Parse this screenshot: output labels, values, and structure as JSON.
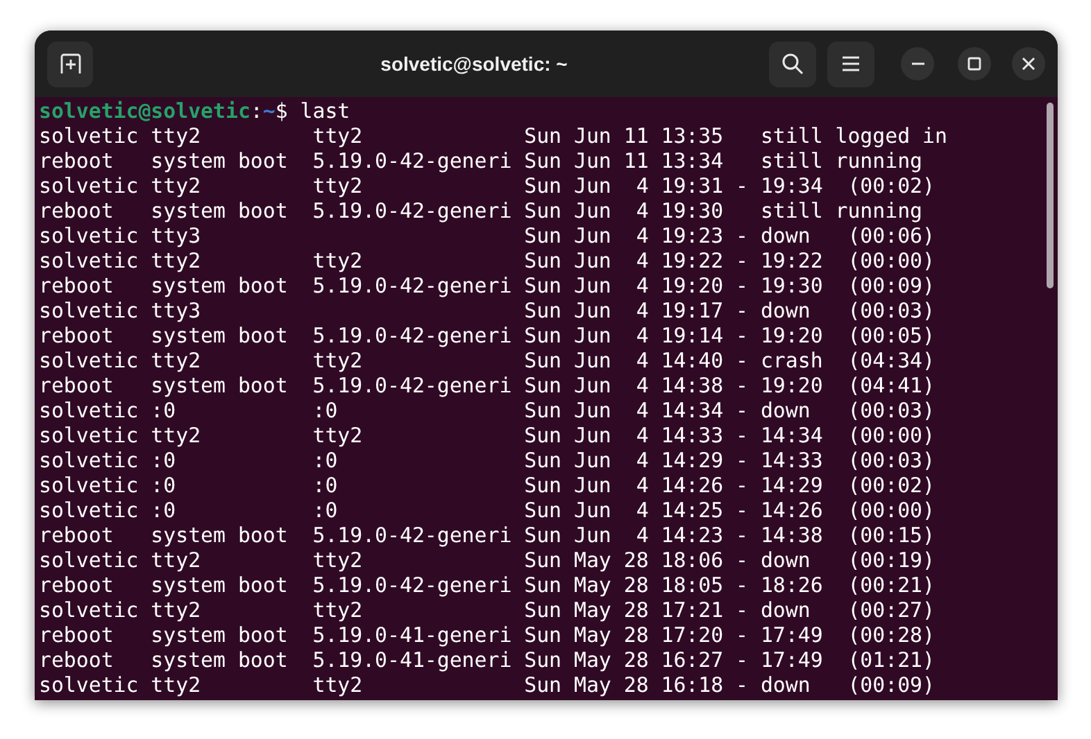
{
  "window": {
    "title": "solvetic@solvetic: ~"
  },
  "terminal": {
    "prompt": {
      "user_host": "solvetic@solvetic",
      "separator": ":",
      "path": "~",
      "symbol": "$",
      "command": "last"
    },
    "lines": [
      "solvetic tty2         tty2             Sun Jun 11 13:35   still logged in",
      "reboot   system boot  5.19.0-42-generi Sun Jun 11 13:34   still running",
      "solvetic tty2         tty2             Sun Jun  4 19:31 - 19:34  (00:02)",
      "reboot   system boot  5.19.0-42-generi Sun Jun  4 19:30   still running",
      "solvetic tty3                          Sun Jun  4 19:23 - down   (00:06)",
      "solvetic tty2         tty2             Sun Jun  4 19:22 - 19:22  (00:00)",
      "reboot   system boot  5.19.0-42-generi Sun Jun  4 19:20 - 19:30  (00:09)",
      "solvetic tty3                          Sun Jun  4 19:17 - down   (00:03)",
      "reboot   system boot  5.19.0-42-generi Sun Jun  4 19:14 - 19:20  (00:05)",
      "solvetic tty2         tty2             Sun Jun  4 14:40 - crash  (04:34)",
      "reboot   system boot  5.19.0-42-generi Sun Jun  4 14:38 - 19:20  (04:41)",
      "solvetic :0           :0               Sun Jun  4 14:34 - down   (00:03)",
      "solvetic tty2         tty2             Sun Jun  4 14:33 - 14:34  (00:00)",
      "solvetic :0           :0               Sun Jun  4 14:29 - 14:33  (00:03)",
      "solvetic :0           :0               Sun Jun  4 14:26 - 14:29  (00:02)",
      "solvetic :0           :0               Sun Jun  4 14:25 - 14:26  (00:00)",
      "reboot   system boot  5.19.0-42-generi Sun Jun  4 14:23 - 14:38  (00:15)",
      "solvetic tty2         tty2             Sun May 28 18:06 - down   (00:19)",
      "reboot   system boot  5.19.0-42-generi Sun May 28 18:05 - 18:26  (00:21)",
      "solvetic tty2         tty2             Sun May 28 17:21 - down   (00:27)",
      "reboot   system boot  5.19.0-41-generi Sun May 28 17:20 - 17:49  (00:28)",
      "reboot   system boot  5.19.0-41-generi Sun May 28 16:27 - 17:49  (01:21)",
      "solvetic tty2         tty2             Sun May 28 16:18 - down   (00:09)"
    ]
  }
}
